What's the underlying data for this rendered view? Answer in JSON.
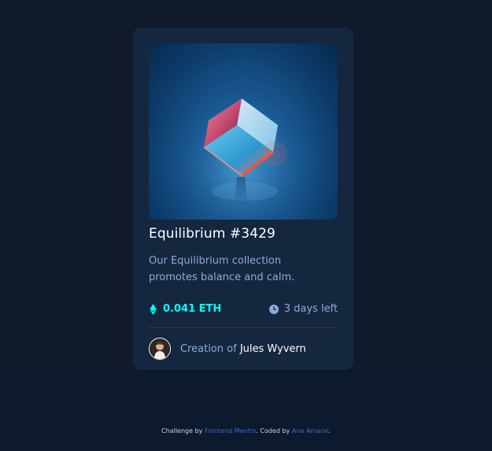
{
  "card": {
    "title": "Equilibrium #3429",
    "description": "Our Equilibrium collection promotes balance and calm.",
    "price": "0.041 ETH",
    "time_left": "3 days left",
    "creator_prefix": "Creation of",
    "creator_name": "Jules Wyvern"
  },
  "attribution": {
    "prefix": "Challenge by",
    "frontend_mentor": "Frontend Mentor",
    "middle": ". Coded by",
    "author": "Ana Amaral",
    "suffix": "."
  },
  "icons": {
    "price": "ethereum-icon",
    "time": "clock-icon"
  },
  "colors": {
    "page_background": "#111a2b",
    "card_background": "#15263f",
    "accent_cyan": "#00fff8",
    "soft_blue": "#8bacd9",
    "link_blue": "#3f6bd1"
  }
}
